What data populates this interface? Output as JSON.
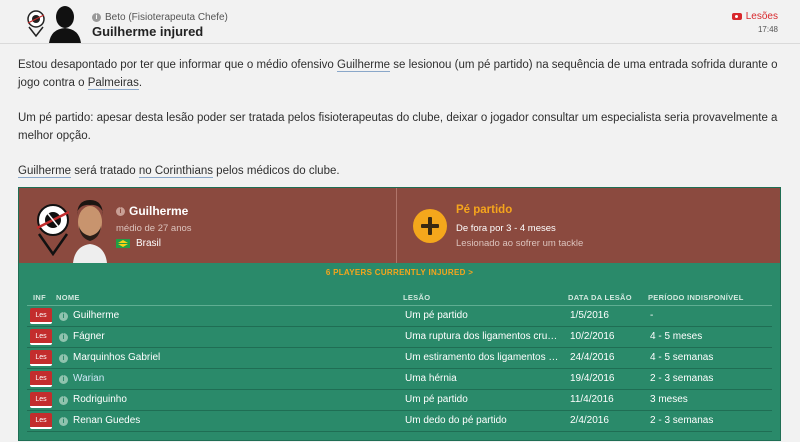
{
  "header": {
    "sender": "Beto  (Fisioterapeuta Chefe)",
    "subject": "Guilherme injured",
    "tag": "Lesões",
    "time": "17:48"
  },
  "message": {
    "p1_a": "Estou desapontado por ter que informar que o médio ofensivo ",
    "p1_name": "Guilherme",
    "p1_b": " se lesionou (um pé partido) na sequência de uma entrada sofrida durante o jogo contra o ",
    "p1_club": "Palmeiras",
    "p1_c": ".",
    "p2": "Um pé partido: apesar desta lesão poder ser tratada pelos fisioterapeutas do clube, deixar o jogador consultar um especialista seria provavelmente a melhor opção.",
    "p3_name": "Guilherme",
    "p3_a": " será tratado ",
    "p3_club": "no Corinthians",
    "p3_b": " pelos médicos do clube."
  },
  "player": {
    "name": "Guilherme",
    "description": "médio de 27 anos",
    "nationality": "Brasil"
  },
  "injury": {
    "title": "Pé partido",
    "detail": "De fora por 3 - 4 meses",
    "cause": "Lesionado ao sofrer um tackle"
  },
  "injured_count_label": "6 PLAYERS CURRENTLY INJURED >",
  "table": {
    "headers": {
      "inf": "INF",
      "nome": "NOME",
      "lesao": "LESÃO",
      "data": "DATA DA LESÃO",
      "periodo": "PERÍODO INDISPONÍVEL"
    },
    "rows": [
      {
        "badge": "Les",
        "name": "Guilherme",
        "lesao": "Um pé partido",
        "data": "1/5/2016",
        "periodo": "-"
      },
      {
        "badge": "Les",
        "name": "Fágner",
        "lesao": "Uma ruptura dos ligamentos cruz...",
        "data": "10/2/2016",
        "periodo": "4 - 5 meses"
      },
      {
        "badge": "Les",
        "name": "Marquinhos Gabriel",
        "lesao": "Um estiramento dos ligamentos d...",
        "data": "24/4/2016",
        "periodo": "4 - 5 semanas"
      },
      {
        "badge": "Les",
        "name": "Warian",
        "lesao": "Uma hérnia",
        "data": "19/4/2016",
        "periodo": "2 - 3 semanas"
      },
      {
        "badge": "Les",
        "name": "Rodriguinho",
        "lesao": "Um pé partido",
        "data": "11/4/2016",
        "periodo": "3 meses"
      },
      {
        "badge": "Les",
        "name": "Renan Guedes",
        "lesao": "Um dedo do pé partido",
        "data": "2/4/2016",
        "periodo": "2 - 3 semanas"
      }
    ]
  }
}
